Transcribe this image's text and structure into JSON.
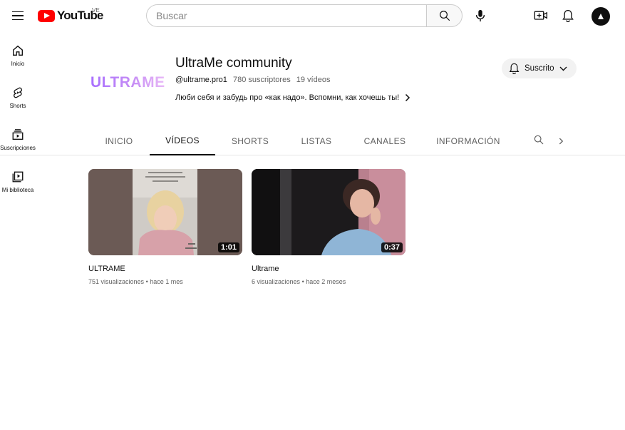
{
  "header": {
    "logo_text": "YouTube",
    "country_code": "VE",
    "search_placeholder": "Buscar"
  },
  "sidebar": {
    "items": [
      {
        "label": "Inicio",
        "icon": "home-icon"
      },
      {
        "label": "Shorts",
        "icon": "shorts-icon"
      },
      {
        "label": "Suscripciones",
        "icon": "subscriptions-icon"
      },
      {
        "label": "Mi biblioteca",
        "icon": "library-icon"
      }
    ]
  },
  "channel": {
    "banner_logo": "ULTRAME",
    "name": "UltraMe community",
    "handle": "@ultrame.pro1",
    "subscribers": "780 suscriptores",
    "video_count": "19 vídeos",
    "description": "Люби себя и забудь про «как надо». Вспомни, как хочешь ты!",
    "subscribe_label": "Suscrito"
  },
  "tabs": [
    {
      "label": "INICIO",
      "active": false
    },
    {
      "label": "VÍDEOS",
      "active": true
    },
    {
      "label": "SHORTS",
      "active": false
    },
    {
      "label": "LISTAS",
      "active": false
    },
    {
      "label": "CANALES",
      "active": false
    },
    {
      "label": "INFORMACIÓN",
      "active": false
    }
  ],
  "videos": [
    {
      "title": "ULTRAME",
      "views": "751 visualizaciones",
      "age": "hace 1 mes",
      "duration": "1:01"
    },
    {
      "title": "Ultrame",
      "views": "6 visualizaciones",
      "age": "hace 2 meses",
      "duration": "0:37"
    }
  ],
  "colors": {
    "brand_red": "#ff0000",
    "text_primary": "#0f0f0f",
    "text_secondary": "#606060",
    "banner_gradient_start": "#a970ff",
    "banner_gradient_end": "#e9b9f7"
  }
}
